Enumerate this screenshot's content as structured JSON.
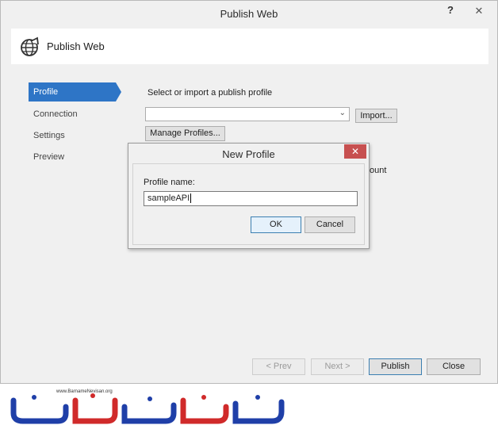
{
  "window": {
    "title": "Publish Web",
    "help_glyph": "?",
    "close_glyph": "✕"
  },
  "header": {
    "title": "Publish Web",
    "icon": "globe-publish-icon"
  },
  "nav": {
    "items": [
      {
        "label": "Profile",
        "active": true
      },
      {
        "label": "Connection",
        "active": false
      },
      {
        "label": "Settings",
        "active": false
      },
      {
        "label": "Preview",
        "active": false
      }
    ]
  },
  "profile": {
    "section_label": "Select or import a publish profile",
    "select_value": "",
    "import_label": "Import...",
    "manage_label": "Manage Profiles...",
    "partial_text": "ount"
  },
  "footer": {
    "prev_label": "< Prev",
    "next_label": "Next >",
    "publish_label": "Publish",
    "close_label": "Close"
  },
  "dialog": {
    "title": "New Profile",
    "close_glyph": "✕",
    "field_label": "Profile name:",
    "field_value": "sampleAPI",
    "ok_label": "OK",
    "cancel_label": "Cancel"
  },
  "watermark": {
    "url": "www.BarnameNevisan.org",
    "logo_text": "برنامه نویسان"
  },
  "colors": {
    "accent": "#2e75c6",
    "close_red": "#c75050",
    "logo_blue": "#1f3fa8",
    "logo_red": "#d02a2a"
  }
}
